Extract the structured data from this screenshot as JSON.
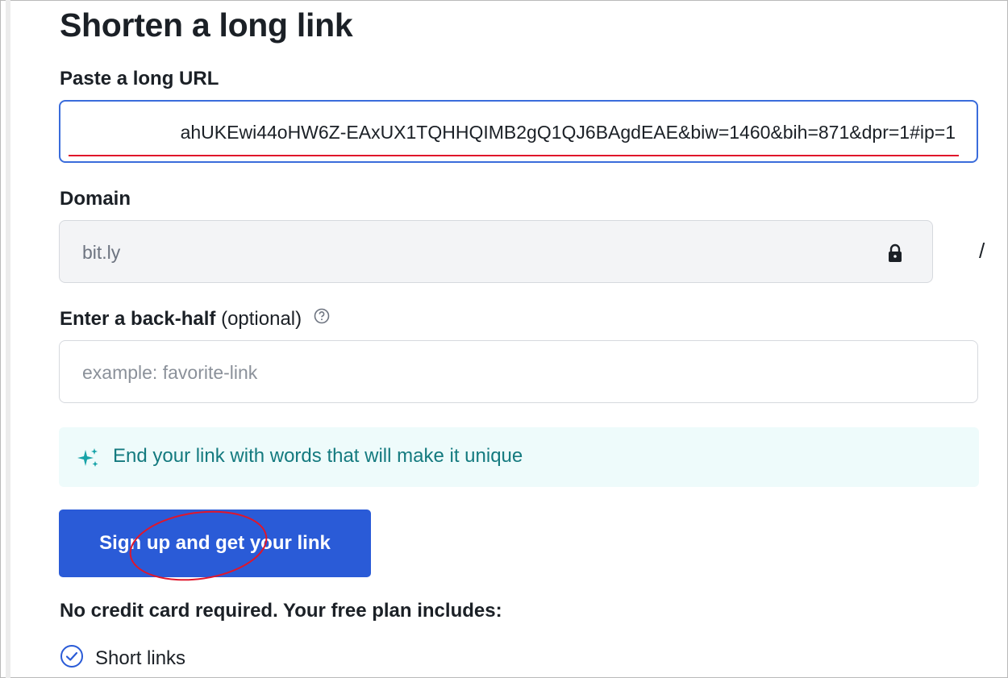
{
  "form": {
    "title": "Shorten a long link",
    "url_label": "Paste a long URL",
    "url_value": "ahUKEwi44oHW6Z-EAxUX1TQHHQIMB2gQ1QJ6BAgdEAE&biw=1460&bih=871&dpr=1#ip=1",
    "domain_label": "Domain",
    "domain_value": "bit.ly",
    "domain_separator": "/",
    "backhalf_label": "Enter a back-half",
    "backhalf_optional": "(optional)",
    "backhalf_placeholder": "example: favorite-link",
    "tip_text": "End your link with words that will make it unique",
    "cta_label": "Sign up and get your link",
    "plan_note": "No credit card required. Your free plan includes:",
    "features": [
      "Short links"
    ]
  },
  "icons": {
    "help": "help-circle-icon",
    "lock": "lock-icon",
    "tip": "sparkles-icon",
    "feature": "check-circle-icon"
  },
  "colors": {
    "primary": "#2a5bd7",
    "focus_border": "#3a6cdb",
    "tip_bg": "#eefbfb",
    "tip_text": "#147a7f",
    "annotation": "#e0162b"
  }
}
